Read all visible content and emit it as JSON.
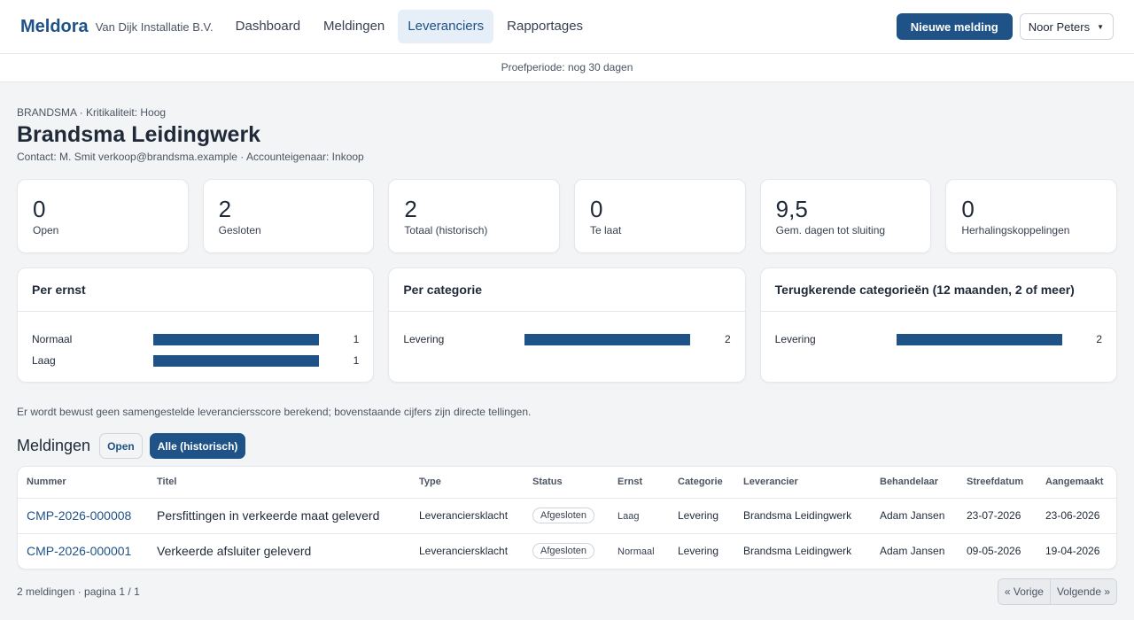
{
  "header": {
    "brand": "Meldora",
    "company": "Van Dijk Installatie B.V.",
    "nav": [
      "Dashboard",
      "Meldingen",
      "Leveranciers",
      "Rapportages"
    ],
    "active_nav": "Leveranciers",
    "new_button": "Nieuwe melding",
    "user": "Noor Peters"
  },
  "trial_banner": "Proefperiode: nog 30 dagen",
  "supplier": {
    "eyebrow": "BRANDSMA · Kritikaliteit: Hoog",
    "name": "Brandsma Leidingwerk",
    "contact": "Contact: M. Smit verkoop@brandsma.example · Accounteigenaar: Inkoop"
  },
  "stats": [
    {
      "value": "0",
      "label": "Open"
    },
    {
      "value": "2",
      "label": "Gesloten"
    },
    {
      "value": "2",
      "label": "Totaal (historisch)"
    },
    {
      "value": "0",
      "label": "Te laat"
    },
    {
      "value": "9,5",
      "label": "Gem. dagen tot sluiting"
    },
    {
      "value": "0",
      "label": "Herhalingskoppelingen"
    }
  ],
  "panels": [
    {
      "title": "Per ernst",
      "rows": [
        {
          "label": "Normaal",
          "count": "1",
          "fraction": 1.0
        },
        {
          "label": "Laag",
          "count": "1",
          "fraction": 1.0
        }
      ]
    },
    {
      "title": "Per categorie",
      "rows": [
        {
          "label": "Levering",
          "count": "2",
          "fraction": 1.0
        }
      ]
    },
    {
      "title": "Terugkerende categorieën (12 maanden, 2 of meer)",
      "rows": [
        {
          "label": "Levering",
          "count": "2",
          "fraction": 1.0
        }
      ]
    }
  ],
  "note": "Er wordt bewust geen samengestelde leveranciersscore berekend; bovenstaande cijfers zijn directe tellingen.",
  "reports": {
    "title": "Meldingen",
    "filter_open": "Open",
    "filter_all": "Alle (historisch)",
    "columns": [
      "Nummer",
      "Titel",
      "Type",
      "Status",
      "Ernst",
      "Categorie",
      "Leverancier",
      "Behandelaar",
      "Streefdatum",
      "Aangemaakt"
    ],
    "rows": [
      [
        "CMP-2026-000008",
        "Persfittingen in verkeerde maat geleverd",
        "Leveranciersklacht",
        "Afgesloten",
        "Laag",
        "Levering",
        "Brandsma Leidingwerk",
        "Adam Jansen",
        "23-07-2026",
        "23-06-2026"
      ],
      [
        "CMP-2026-000001",
        "Verkeerde afsluiter geleverd",
        "Leveranciersklacht",
        "Afgesloten",
        "Normaal",
        "Levering",
        "Brandsma Leidingwerk",
        "Adam Jansen",
        "09-05-2026",
        "19-04-2026"
      ]
    ],
    "footer": "2 meldingen · pagina 1 / 1",
    "prev": "« Vorige",
    "next": "Volgende »"
  },
  "colors": {
    "accent": "#1f5286",
    "background": "#f3f4f6"
  }
}
